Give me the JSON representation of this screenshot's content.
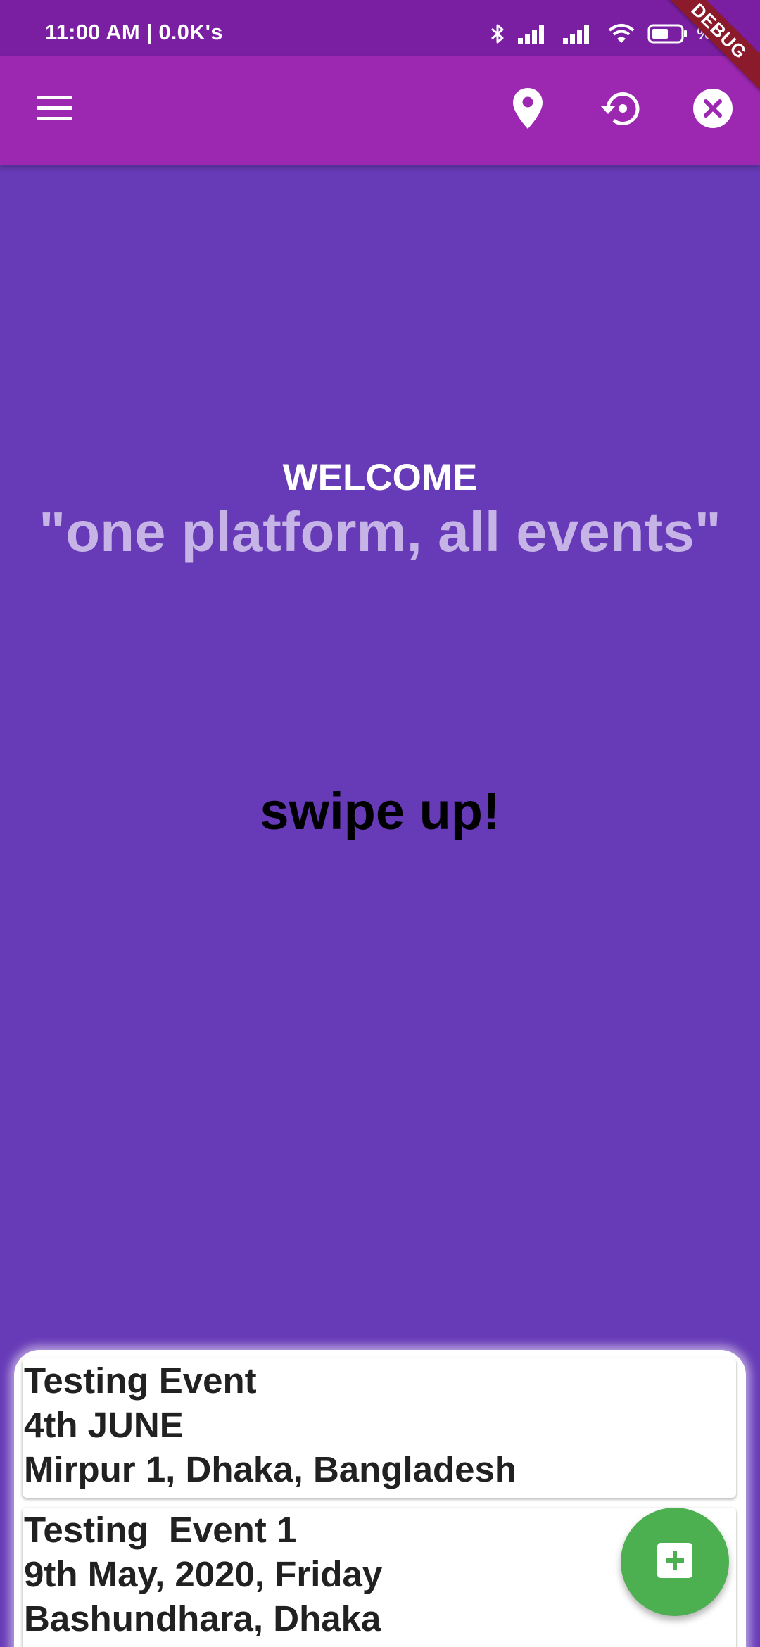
{
  "status_bar": {
    "time": "11:00 AM | 0.0K's",
    "battery_pct": "%",
    "icons": [
      "bluetooth-icon",
      "signal-icon",
      "signal-icon",
      "wifi-icon",
      "battery-icon"
    ]
  },
  "debug_banner": "DEBUG",
  "app_bar": {
    "icons": [
      "menu-icon",
      "location-pin-icon",
      "history-icon",
      "close-circle-icon"
    ],
    "color": "#9c27b0"
  },
  "main": {
    "welcome": "WELCOME",
    "tagline": "\"one platform, all events\"",
    "swipe_hint": "swipe up!",
    "background": "#673ab7"
  },
  "events": [
    {
      "name": "Testing Event",
      "date": "4th JUNE",
      "location": "Mirpur 1, Dhaka, Bangladesh"
    },
    {
      "name": "Testing  Event 1",
      "date": "9th May, 2020, Friday",
      "location": "Bashundhara, Dhaka"
    }
  ],
  "fab": {
    "icon": "add-box-icon",
    "color": "#4caf50"
  }
}
